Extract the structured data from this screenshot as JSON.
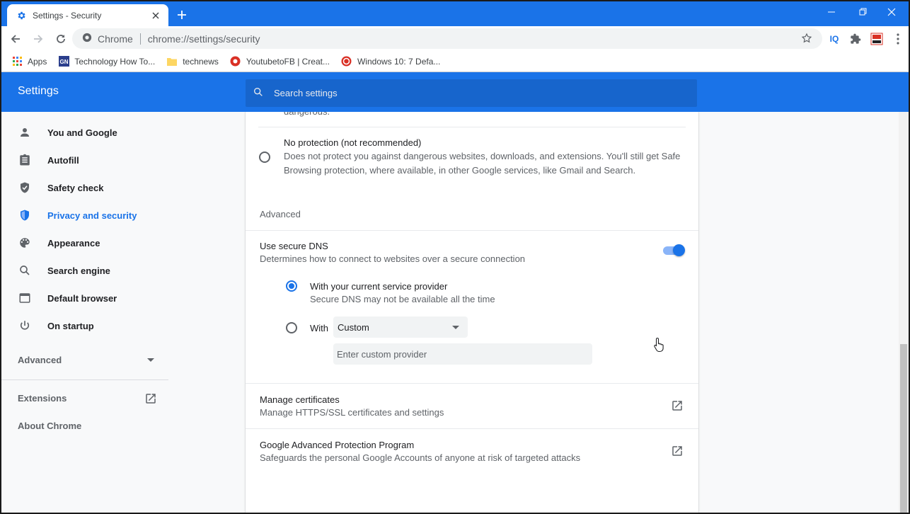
{
  "browser": {
    "tab_title": "Settings - Security",
    "omnibox_site": "Chrome",
    "omnibox_url": "chrome://settings/security",
    "accent": "#1a73e8",
    "bookmarks": [
      {
        "label": "Apps",
        "icon": "apps-grid-icon"
      },
      {
        "label": "Technology How To...",
        "icon": "gn-site-icon"
      },
      {
        "label": "technews",
        "icon": "folder-icon"
      },
      {
        "label": "YoutubetoFB | Creat...",
        "icon": "youtube-fb-icon"
      },
      {
        "label": "Windows 10: 7 Defa...",
        "icon": "windows-site-icon"
      }
    ]
  },
  "settings": {
    "title": "Settings",
    "search_placeholder": "Search settings",
    "nav": [
      {
        "label": "You and Google",
        "icon": "person-icon"
      },
      {
        "label": "Autofill",
        "icon": "clipboard-icon"
      },
      {
        "label": "Safety check",
        "icon": "shield-check-icon"
      },
      {
        "label": "Privacy and security",
        "icon": "shield-icon"
      },
      {
        "label": "Appearance",
        "icon": "palette-icon"
      },
      {
        "label": "Search engine",
        "icon": "search-icon"
      },
      {
        "label": "Default browser",
        "icon": "browser-window-icon"
      },
      {
        "label": "On startup",
        "icon": "power-icon"
      }
    ],
    "advanced_label": "Advanced",
    "extensions_label": "Extensions",
    "about_label": "About Chrome"
  },
  "content": {
    "cut_text": "dangerous.",
    "no_protection": {
      "title": "No protection (not recommended)",
      "desc_line1": "Does not protect you against dangerous websites, downloads, and extensions. You'll still get Safe",
      "desc_line2": "Browsing protection, where available, in other Google services, like Gmail and Search."
    },
    "advanced_heading": "Advanced",
    "secure_dns": {
      "title": "Use secure DNS",
      "desc": "Determines how to connect to websites over a secure connection",
      "enabled": true,
      "option1_title": "With your current service provider",
      "option1_desc": "Secure DNS may not be available all the time",
      "option2_label": "With",
      "dropdown_value": "Custom",
      "custom_placeholder": "Enter custom provider"
    },
    "certificates": {
      "title": "Manage certificates",
      "desc": "Manage HTTPS/SSL certificates and settings"
    },
    "protection_program": {
      "title": "Google Advanced Protection Program",
      "desc": "Safeguards the personal Google Accounts of anyone at risk of targeted attacks"
    }
  }
}
